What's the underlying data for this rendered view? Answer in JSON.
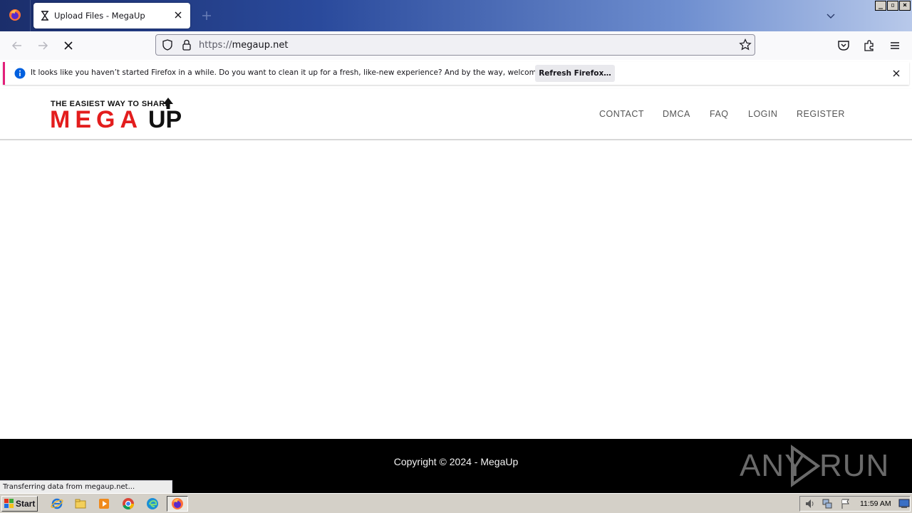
{
  "browser": {
    "tab": {
      "title": "Upload Files - MegaUp"
    },
    "url": {
      "scheme": "https://",
      "host": "megaup.net"
    },
    "notification": {
      "message": "It looks like you haven’t started Firefox in a while. Do you want to clean it up for a fresh, like-new experience? And by the way, welcome back!",
      "button": "Refresh Firefox…"
    },
    "status_text": "Transferring data from megaup.net..."
  },
  "site": {
    "logo": {
      "tagline": "THE EASIEST WAY TO SHARE",
      "mega": "MEGA",
      "up": "UP"
    },
    "nav": [
      "CONTACT",
      "DMCA",
      "FAQ",
      "LOGIN",
      "REGISTER"
    ],
    "footer": "Copyright © 2024 - MegaUp"
  },
  "watermark": {
    "left": "ANY",
    "right": "RUN"
  },
  "taskbar": {
    "start": "Start",
    "icons": [
      "ie-icon",
      "explorer-icon",
      "media-player-icon",
      "chrome-icon",
      "edge-icon",
      "firefox-icon"
    ],
    "clock": "11:59 AM"
  },
  "colors": {
    "brand_red": "#e31d1d",
    "notification_accent": "#e3207a",
    "footer_bg": "#000000"
  }
}
